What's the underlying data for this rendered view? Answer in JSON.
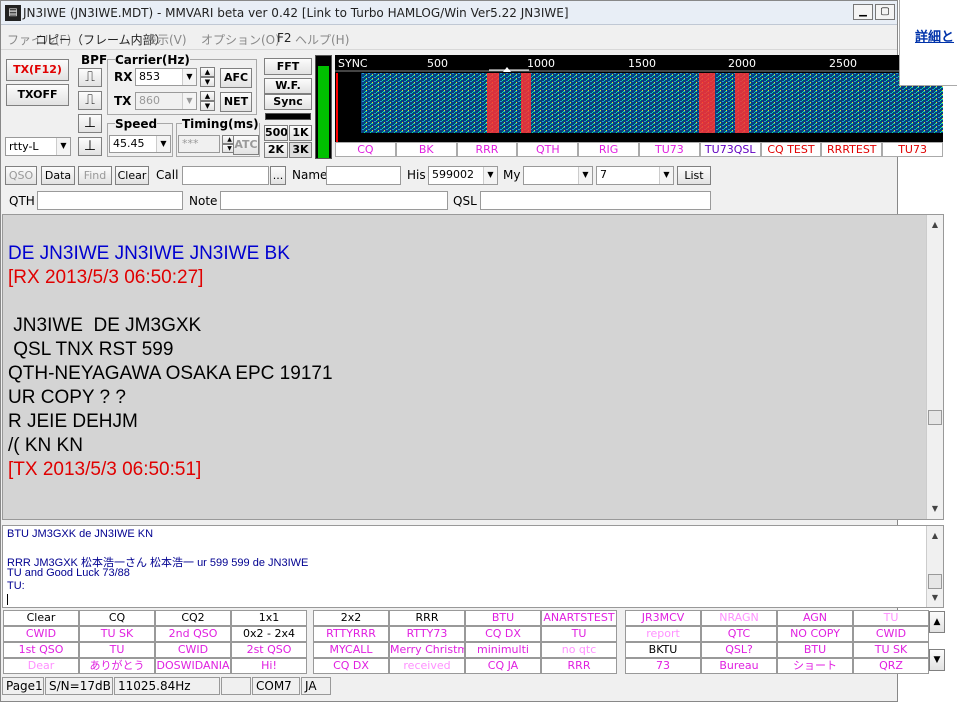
{
  "window": {
    "title": "JN3IWE (JN3IWE.MDT) - MMVARI beta ver 0.42 [Link to Turbo HAMLOG/Win Ver5.22 JN3IWE]",
    "icon": "app-icon"
  },
  "external": {
    "link": "詳細と"
  },
  "menu": [
    "ファイル(F)",
    "コピー（フレーム内部）",
    "表示(V)",
    "オプション(O)",
    "F2",
    "ヘルプ(H)"
  ],
  "controls": {
    "tx": "TX(F12)",
    "txoff": "TXOFF",
    "bpf": "BPF",
    "carrier": "Carrier(Hz)",
    "rx_label": "RX",
    "rx_value": "853",
    "tx_label": "TX",
    "tx_value": "860",
    "afc": "AFC",
    "net": "NET",
    "fft": "FFT",
    "wf": "W.F.",
    "sync": "Sync",
    "b500": "500",
    "b1k": "1K",
    "b2k": "2K",
    "b3k": "3K",
    "mode": "rtty-L",
    "speed_label": "Speed",
    "speed_value": "45.45",
    "timing_label": "Timing(ms)",
    "timing_value": "***",
    "atc": "ATC"
  },
  "spectrum": {
    "axis": [
      "SYNC",
      "500",
      "1000",
      "1500",
      "2000",
      "2500"
    ],
    "colors": {
      "bg": "#000000",
      "noise": "#18c8c8",
      "signal": "#ff3030",
      "marker": "#ff0000"
    },
    "buttons": [
      {
        "label": "CQ",
        "color": "#e020e0"
      },
      {
        "label": "BK",
        "color": "#e020e0"
      },
      {
        "label": "RRR",
        "color": "#e020e0"
      },
      {
        "label": "QTH",
        "color": "#e020e0"
      },
      {
        "label": "RIG",
        "color": "#e020e0"
      },
      {
        "label": "TU73",
        "color": "#e020e0"
      },
      {
        "label": "TU73QSL",
        "color": "#6000c0"
      },
      {
        "label": "CQ TEST",
        "color": "#e00000"
      },
      {
        "label": "RRRTEST",
        "color": "#e00000"
      },
      {
        "label": "TU73",
        "color": "#e00000"
      }
    ]
  },
  "log": {
    "qso": "QSO",
    "data": "Data",
    "find": "Find",
    "clear": "Clear",
    "call_label": "Call",
    "call": "",
    "more": "...",
    "name_label": "Name",
    "name": "",
    "his_label": "His",
    "his": "599002",
    "my_label": "My",
    "my": "",
    "num": "7",
    "list": "List",
    "qth_label": "QTH",
    "qth": "",
    "note_label": "Note",
    "note": "",
    "qsl_label": "QSL",
    "qsl": ""
  },
  "rx": [
    {
      "text": "DE JN3IWE JN3IWE JN3IWE BK",
      "color": "#0000d0"
    },
    {
      "text": "[RX 2013/5/3 06:50:27]",
      "color": "#e00000"
    },
    {
      "text": "",
      "color": "#000000"
    },
    {
      "text": " JN3IWE  DE JM3GXK",
      "color": "#000000"
    },
    {
      "text": " QSL TNX RST 599",
      "color": "#000000"
    },
    {
      "text": "QTH-NEYAGAWA OSAKA EPC 19171",
      "color": "#000000"
    },
    {
      "text": "UR COPY ? ?",
      "color": "#000000"
    },
    {
      "text": "R JEIE DEHJM",
      "color": "#000000"
    },
    {
      "text": "/( KN KN",
      "color": "#000000"
    },
    {
      "text": "[TX 2013/5/3 06:50:51]",
      "color": "#e00000"
    }
  ],
  "tx": [
    "BTU JM3GXK de JN3IWE KN",
    "",
    "RRR JM3GXK 松本浩一さん 松本浩一 ur 599 599 de JN3IWE",
    "TU and Good Luck 73/88",
    "TU:"
  ],
  "macros": [
    [
      {
        "t": "Clear",
        "c": "#000000"
      },
      {
        "t": "CQ",
        "c": "#000000"
      },
      {
        "t": "CQ2",
        "c": "#000000"
      },
      {
        "t": "1x1",
        "c": "#000000"
      },
      {
        "t": "2x2",
        "c": "#000000"
      },
      {
        "t": "RRR",
        "c": "#000000"
      },
      {
        "t": "BTU",
        "c": "#e020e0"
      },
      {
        "t": "ANARTSTEST",
        "c": "#e020e0"
      },
      {
        "t": "JR3MCV",
        "c": "#e020e0"
      },
      {
        "t": "NRAGN",
        "c": "#ff90ff"
      },
      {
        "t": "AGN",
        "c": "#e020e0"
      },
      {
        "t": "TU",
        "c": "#ff90ff"
      }
    ],
    [
      {
        "t": "CWID",
        "c": "#e020e0"
      },
      {
        "t": "TU SK",
        "c": "#e020e0"
      },
      {
        "t": "2nd QSO",
        "c": "#e020e0"
      },
      {
        "t": "0x2 - 2x4",
        "c": "#000000"
      },
      {
        "t": "RTTYRRR",
        "c": "#e020e0"
      },
      {
        "t": "RTTY73",
        "c": "#e020e0"
      },
      {
        "t": "CQ DX",
        "c": "#e020e0"
      },
      {
        "t": "TU",
        "c": "#e020e0"
      },
      {
        "t": "report",
        "c": "#ff90ff"
      },
      {
        "t": "QTC",
        "c": "#e020e0"
      },
      {
        "t": "NO COPY",
        "c": "#e020e0"
      },
      {
        "t": "CWID",
        "c": "#e020e0"
      }
    ],
    [
      {
        "t": "1st QSO",
        "c": "#e020e0"
      },
      {
        "t": "TU",
        "c": "#e020e0"
      },
      {
        "t": "CWID",
        "c": "#e020e0"
      },
      {
        "t": "2st QSO",
        "c": "#e020e0"
      },
      {
        "t": "MYCALL",
        "c": "#e020e0"
      },
      {
        "t": "Merry Christmas",
        "c": "#e020e0"
      },
      {
        "t": "minimulti",
        "c": "#e020e0"
      },
      {
        "t": "no qtc",
        "c": "#ff90ff"
      },
      {
        "t": "BKTU",
        "c": "#000000"
      },
      {
        "t": "QSL?",
        "c": "#e020e0"
      },
      {
        "t": "BTU",
        "c": "#e020e0"
      },
      {
        "t": "TU SK",
        "c": "#e020e0"
      }
    ],
    [
      {
        "t": "Dear",
        "c": "#ff90ff"
      },
      {
        "t": "ありがとう",
        "c": "#e020e0"
      },
      {
        "t": "DOSWIDANIA",
        "c": "#e020e0"
      },
      {
        "t": "Hi!",
        "c": "#e020e0"
      },
      {
        "t": "CQ DX",
        "c": "#e020e0"
      },
      {
        "t": "received",
        "c": "#ff90ff"
      },
      {
        "t": "CQ JA",
        "c": "#e020e0"
      },
      {
        "t": "RRR",
        "c": "#e020e0"
      },
      {
        "t": "73",
        "c": "#e020e0"
      },
      {
        "t": "Bureau",
        "c": "#e020e0"
      },
      {
        "t": "ショート",
        "c": "#e020e0"
      },
      {
        "t": "QRZ",
        "c": "#e020e0"
      }
    ]
  ],
  "status": [
    "Page1",
    "S/N=17dB",
    "11025.84Hz",
    "",
    "COM7",
    "JA"
  ]
}
